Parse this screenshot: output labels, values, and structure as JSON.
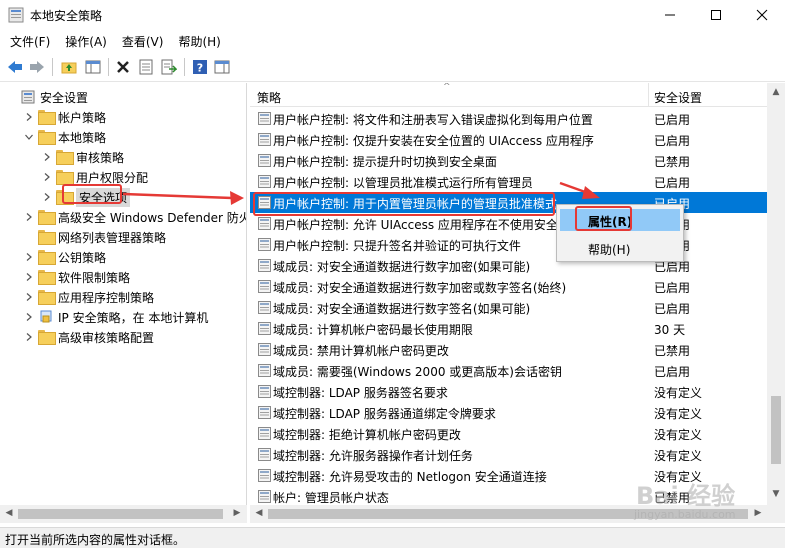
{
  "window": {
    "title": "本地安全策略"
  },
  "menu": [
    "文件(F)",
    "操作(A)",
    "查看(V)",
    "帮助(H)"
  ],
  "tree": [
    {
      "label": "安全设置",
      "depth": 0,
      "expander": "none",
      "icon": "shield-settings-icon"
    },
    {
      "label": "帐户策略",
      "depth": 1,
      "expander": "collapsed",
      "icon": "folder-icon"
    },
    {
      "label": "本地策略",
      "depth": 1,
      "expander": "expanded",
      "icon": "folder-icon"
    },
    {
      "label": "审核策略",
      "depth": 2,
      "expander": "collapsed",
      "icon": "folder-icon"
    },
    {
      "label": "用户权限分配",
      "depth": 2,
      "expander": "collapsed",
      "icon": "folder-icon"
    },
    {
      "label": "安全选项",
      "depth": 2,
      "expander": "collapsed",
      "icon": "folder-icon",
      "selected": true
    },
    {
      "label": "高级安全 Windows Defender 防火墙",
      "depth": 1,
      "expander": "collapsed",
      "icon": "folder-icon"
    },
    {
      "label": "网络列表管理器策略",
      "depth": 1,
      "expander": "none",
      "icon": "folder-icon"
    },
    {
      "label": "公钥策略",
      "depth": 1,
      "expander": "collapsed",
      "icon": "folder-icon"
    },
    {
      "label": "软件限制策略",
      "depth": 1,
      "expander": "collapsed",
      "icon": "folder-icon"
    },
    {
      "label": "应用程序控制策略",
      "depth": 1,
      "expander": "collapsed",
      "icon": "folder-icon"
    },
    {
      "label": "IP 安全策略，在 本地计算机",
      "depth": 1,
      "expander": "collapsed",
      "icon": "ip-security-icon"
    },
    {
      "label": "高级审核策略配置",
      "depth": 1,
      "expander": "collapsed",
      "icon": "folder-icon"
    }
  ],
  "columns": {
    "policy": "策略",
    "setting": "安全设置"
  },
  "policies": [
    {
      "name": "用户帐户控制: 将文件和注册表写入错误虚拟化到每用户位置",
      "value": "已启用"
    },
    {
      "name": "用户帐户控制: 仅提升安装在安全位置的 UIAccess 应用程序",
      "value": "已启用"
    },
    {
      "name": "用户帐户控制: 提示提升时切换到安全桌面",
      "value": "已禁用"
    },
    {
      "name": "用户帐户控制: 以管理员批准模式运行所有管理员",
      "value": "已启用"
    },
    {
      "name": "用户帐户控制: 用于内置管理员帐户的管理员批准模式",
      "value": "已启用",
      "selected": true
    },
    {
      "name": "用户帐户控制: 允许 UIAccess 应用程序在不使用安全桌面的情况下提升权限",
      "value": "已禁用"
    },
    {
      "name": "用户帐户控制: 只提升签名并验证的可执行文件",
      "value": "已禁用"
    },
    {
      "name": "域成员: 对安全通道数据进行数字加密(如果可能)",
      "value": "已启用"
    },
    {
      "name": "域成员: 对安全通道数据进行数字加密或数字签名(始终)",
      "value": "已启用"
    },
    {
      "name": "域成员: 对安全通道数据进行数字签名(如果可能)",
      "value": "已启用"
    },
    {
      "name": "域成员: 计算机帐户密码最长使用期限",
      "value": "30 天"
    },
    {
      "name": "域成员: 禁用计算机帐户密码更改",
      "value": "已禁用"
    },
    {
      "name": "域成员: 需要强(Windows 2000 或更高版本)会话密钥",
      "value": "已启用"
    },
    {
      "name": "域控制器: LDAP 服务器签名要求",
      "value": "没有定义"
    },
    {
      "name": "域控制器: LDAP 服务器通道绑定令牌要求",
      "value": "没有定义"
    },
    {
      "name": "域控制器: 拒绝计算机帐户密码更改",
      "value": "没有定义"
    },
    {
      "name": "域控制器: 允许服务器操作者计划任务",
      "value": "没有定义"
    },
    {
      "name": "域控制器: 允许易受攻击的 Netlogon 安全通道连接",
      "value": "没有定义"
    },
    {
      "name": "帐户: 管理员帐户状态",
      "value": "已禁用"
    }
  ],
  "context_menu": {
    "properties": "属性(R)",
    "help": "帮助(H)"
  },
  "status": "打开当前所选内容的属性对话框。",
  "watermark": {
    "brand": "Bai 经验",
    "url": "jingyan.baidu.com"
  },
  "colors": {
    "selection": "#0078d7",
    "annotation": "#e53935",
    "context_highlight": "#91c9f7"
  }
}
